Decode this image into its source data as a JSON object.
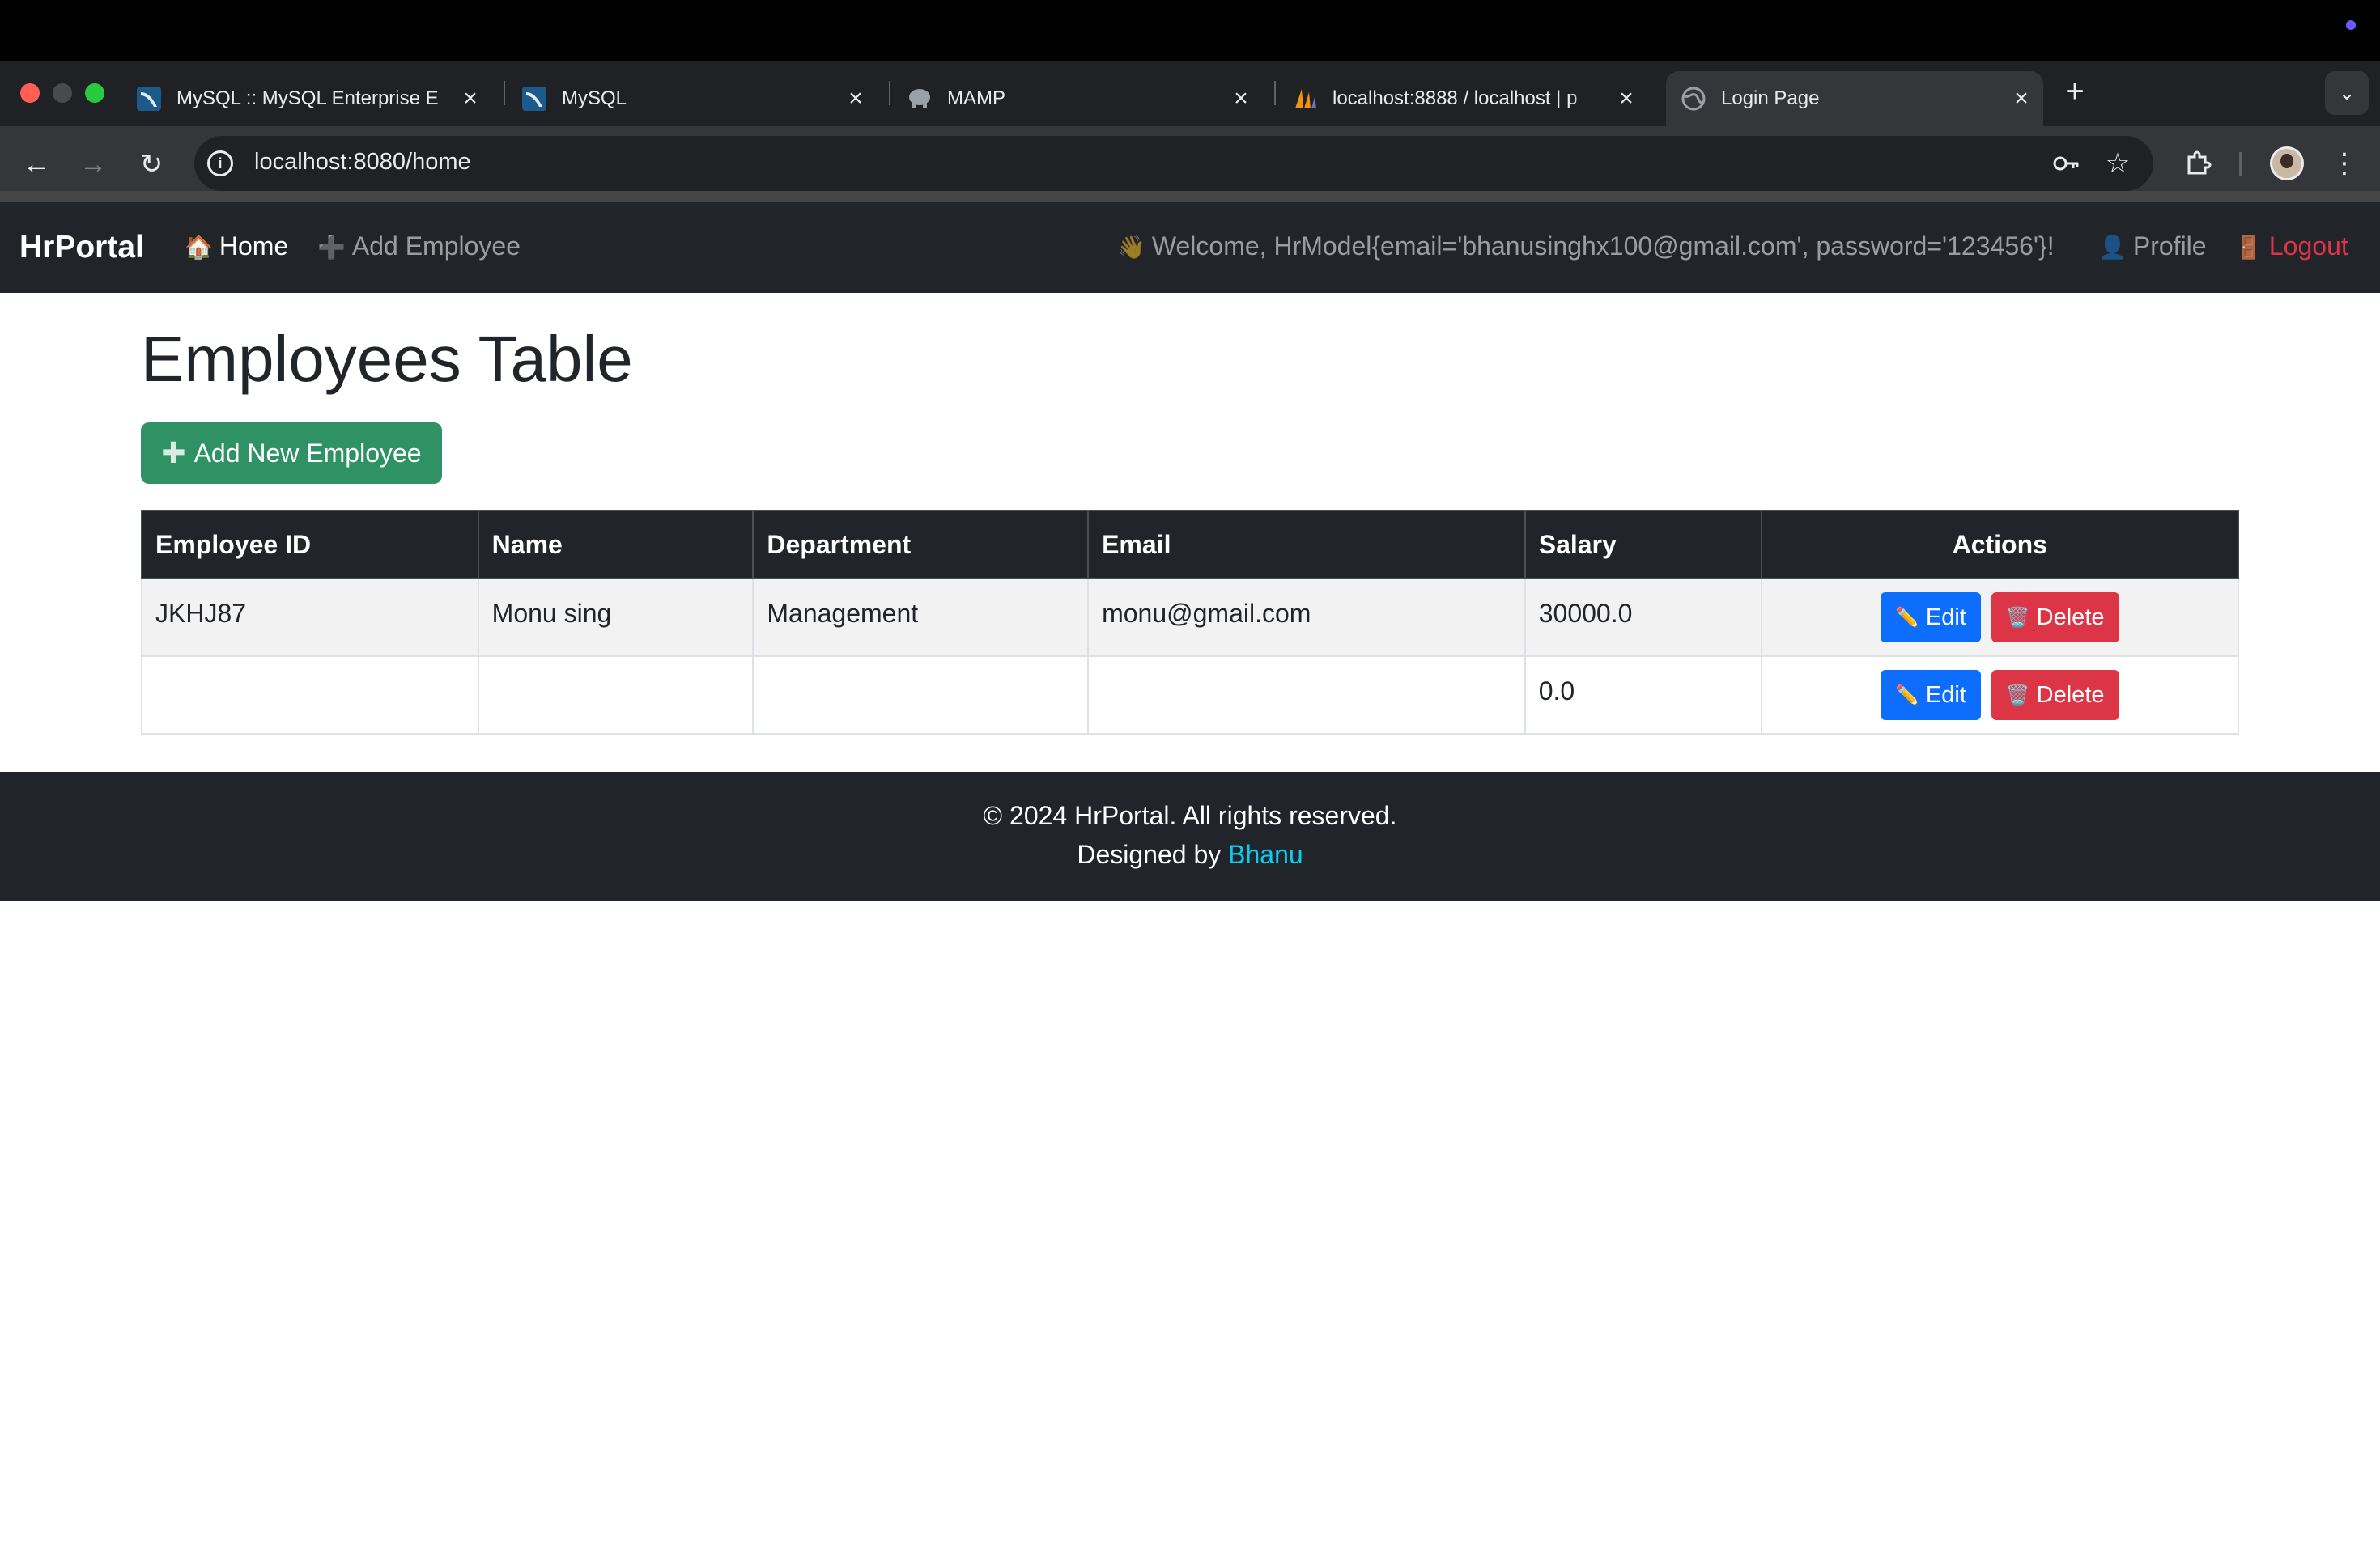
{
  "browser": {
    "tabs": [
      {
        "title": "MySQL :: MySQL Enterprise E",
        "favicon": "mysql-dolphin-icon",
        "active": false
      },
      {
        "title": "MySQL",
        "favicon": "mysql-dolphin-icon",
        "active": false
      },
      {
        "title": "MAMP",
        "favicon": "mamp-elephant-icon",
        "active": false
      },
      {
        "title": "localhost:8888 / localhost | p",
        "favicon": "phpmyadmin-sail-icon",
        "active": false
      },
      {
        "title": "Login Page",
        "favicon": "globe-icon",
        "active": true
      }
    ],
    "url": "localhost:8080/home"
  },
  "navbar": {
    "brand": "HrPortal",
    "home": "Home",
    "add_employee": "Add Employee",
    "welcome": "Welcome, HrModel{email='bhanusinghx100@gmail.com', password='123456'}!",
    "profile": "Profile",
    "logout": "Logout"
  },
  "main": {
    "title": "Employees Table",
    "add_button": "Add New Employee",
    "table": {
      "headers": [
        "Employee ID",
        "Name",
        "Department",
        "Email",
        "Salary",
        "Actions"
      ],
      "rows": [
        {
          "id": "JKHJ87",
          "name": "Monu sing",
          "department": "Management",
          "email": "monu@gmail.com",
          "salary": "30000.0"
        },
        {
          "id": "",
          "name": "",
          "department": "",
          "email": "",
          "salary": "0.0"
        }
      ],
      "edit_label": "Edit",
      "delete_label": "Delete"
    }
  },
  "footer": {
    "copyright": "© 2024 HrPortal. All rights reserved.",
    "designed_by": "Designed by",
    "designer": "Bhanu"
  },
  "colors": {
    "navbar_bg": "#212529",
    "success": "#198754",
    "primary": "#0d6efd",
    "danger": "#dc3545",
    "info": "#0dcaf0"
  }
}
